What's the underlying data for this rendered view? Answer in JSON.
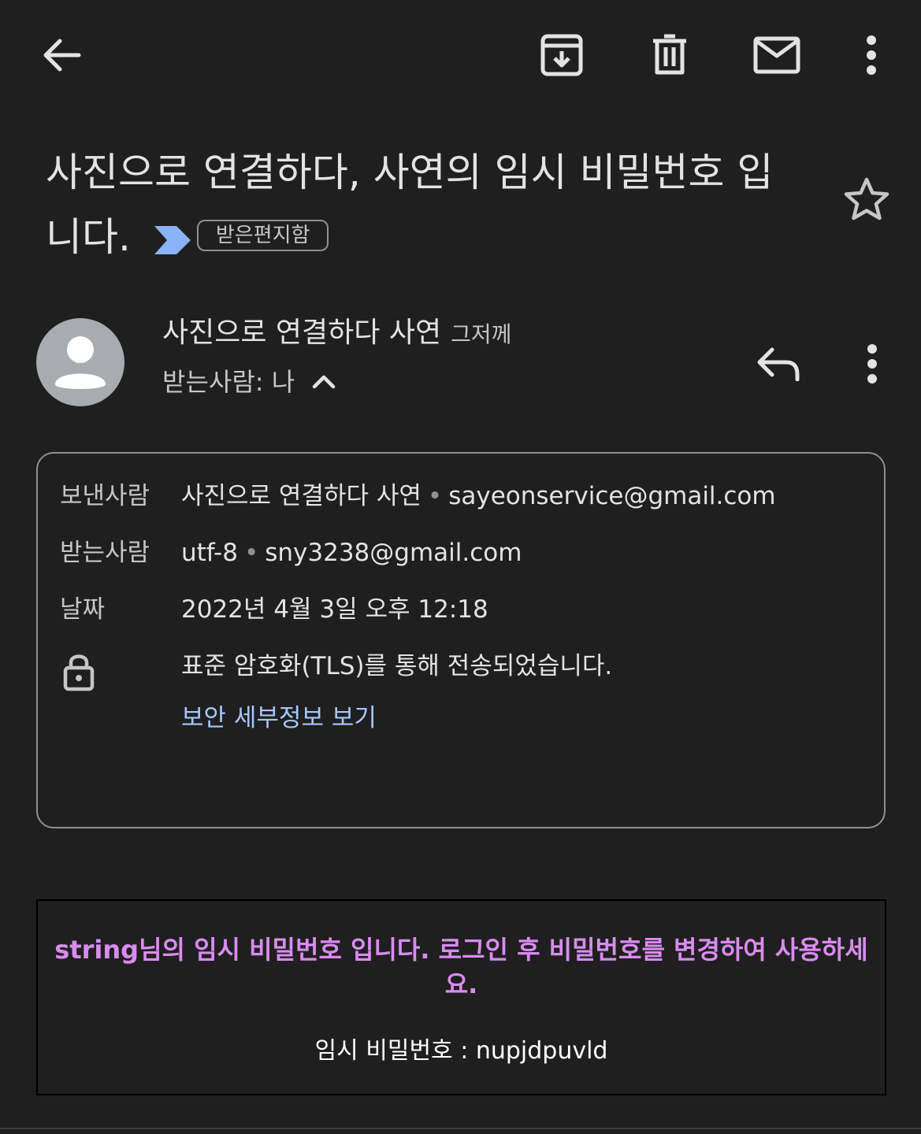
{
  "toolbar": {
    "back_icon": "arrow-back-icon",
    "archive_icon": "archive-icon",
    "delete_icon": "trash-icon",
    "mark_unread_icon": "mail-icon",
    "more_icon": "more-vert-icon"
  },
  "subject": {
    "title": "사진으로 연결하다, 사연의 임시 비밀번호 입니다.",
    "importance_icon": "importance-marker-icon",
    "label": "받은편지함",
    "star_icon": "star-outline-icon"
  },
  "sender": {
    "avatar_icon": "person-avatar-icon",
    "name": "사진으로 연결하다 사연",
    "time": "그저께",
    "to_line": "받는사람: 나",
    "collapse_icon": "chevron-up-icon",
    "reply_icon": "reply-icon",
    "more_icon": "more-vert-icon"
  },
  "details": {
    "from_label": "보낸사람",
    "from_name": "사진으로 연결하다 사연",
    "from_email": "sayeonservice@gmail.com",
    "to_label": "받는사람",
    "to_name": "utf-8",
    "to_email": "sny3238@gmail.com",
    "date_label": "날짜",
    "date_value": "2022년 4월 3일 오후 12:18",
    "lock_icon": "lock-icon",
    "security_text": "표준 암호화(TLS)를 통해 전송되었습니다.",
    "security_link": "보안 세부정보 보기",
    "separator": "•"
  },
  "body": {
    "message": "string님의 임시 비밀번호 입니다. 로그인 후 비밀번호를 변경하여 사용하세요.",
    "password_line": "임시 비밀번호 : nupjdpuvld"
  },
  "colors": {
    "background": "#1f1f1f",
    "text": "#e3e3e3",
    "muted": "#c4c7c5",
    "link": "#a8c7fa",
    "importance": "#8ab4f8",
    "body_text": "#d98cf0"
  }
}
